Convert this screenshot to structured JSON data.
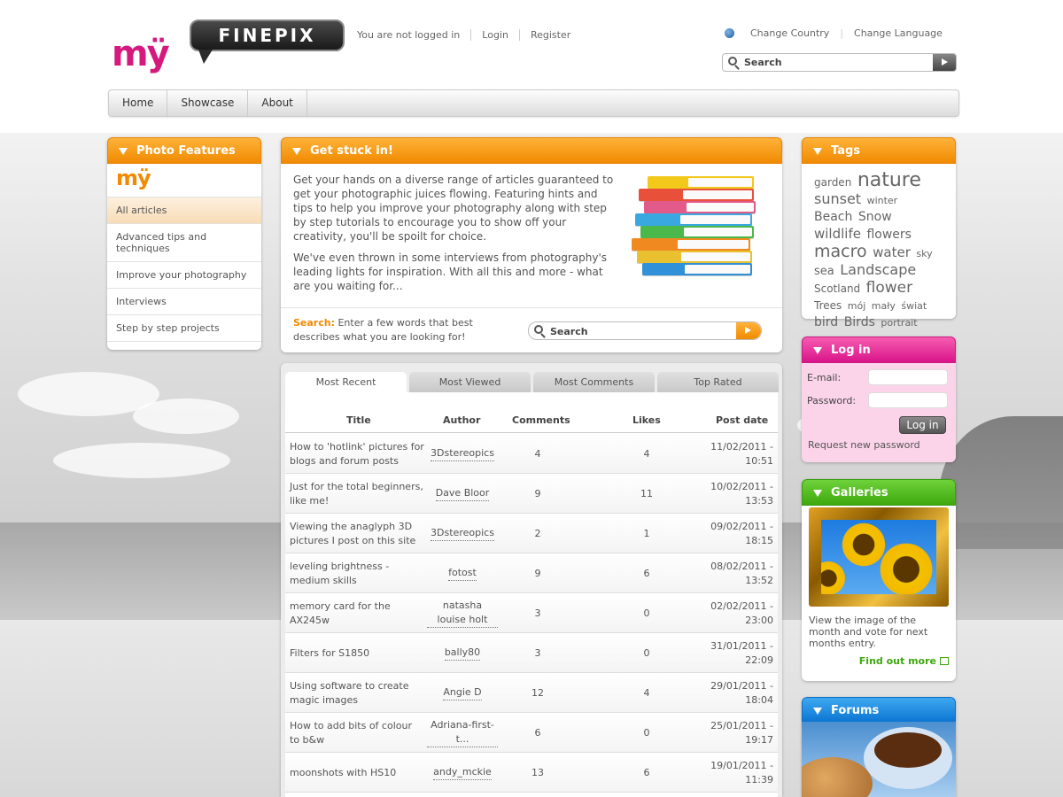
{
  "header": {
    "logo_my": "mÿ",
    "logo_text": "FINEPIX",
    "status": "You are not logged in",
    "login_link": "Login",
    "register_link": "Register",
    "change_country": "Change Country",
    "change_language": "Change Language",
    "search_placeholder": "Search"
  },
  "nav": [
    "Home",
    "Showcase",
    "About"
  ],
  "photo_features": {
    "title": "Photo Features",
    "logo": "mÿ",
    "items": [
      "All articles",
      "Advanced tips and techniques",
      "Improve your photography",
      "Interviews",
      "Step by step projects"
    ]
  },
  "main": {
    "title": "Get stuck in!",
    "para1": "Get your hands on a diverse range of articles guaranteed to get your photographic juices flowing. Featuring hints and tips to help you improve your photography along with step by step tutorials to encourage you to show off your creativity, you'll be spoilt for choice.",
    "para2": "We've even thrown in some interviews from photography's leading lights for inspiration. With all this and more - what are you waiting for...",
    "search_label": "Search:",
    "search_prompt": "Enter a few words that best describes what you are looking for!",
    "search_placeholder": "Search"
  },
  "tabs": [
    "Most Recent",
    "Most Viewed",
    "Most Comments",
    "Top Rated"
  ],
  "table": {
    "headers": [
      "Title",
      "Author",
      "Comments",
      "Likes",
      "Post date"
    ],
    "rows": [
      {
        "title": "How to 'hotlink' pictures for blogs and forum posts",
        "author": "3Dstereopics",
        "comments": "4",
        "likes": "4",
        "date": "11/02/2011 - 10:51"
      },
      {
        "title": "Just for the total beginners, like me!",
        "author": "Dave Bloor",
        "comments": "9",
        "likes": "11",
        "date": "10/02/2011 - 13:53"
      },
      {
        "title": "Viewing the anaglyph 3D pictures I post on this site",
        "author": "3Dstereopics",
        "comments": "2",
        "likes": "1",
        "date": "09/02/2011 - 18:15"
      },
      {
        "title": "leveling brightness - medium skills",
        "author": "fotost",
        "comments": "9",
        "likes": "6",
        "date": "08/02/2011 - 13:52"
      },
      {
        "title": "memory card for the AX245w",
        "author": "natasha louise holt",
        "comments": "3",
        "likes": "0",
        "date": "02/02/2011 - 23:00"
      },
      {
        "title": "Filters for S1850",
        "author": "bally80",
        "comments": "3",
        "likes": "0",
        "date": "31/01/2011 - 22:09"
      },
      {
        "title": "Using software to create magic images",
        "author": "Angie D",
        "comments": "12",
        "likes": "4",
        "date": "29/01/2011 - 18:04"
      },
      {
        "title": "How to add bits of colour to b&w",
        "author": "Adriana-first-t...",
        "comments": "6",
        "likes": "0",
        "date": "25/01/2011 - 19:17"
      },
      {
        "title": "moonshots with HS10",
        "author": "andy_mckie",
        "comments": "13",
        "likes": "6",
        "date": "19/01/2011 - 11:39"
      }
    ]
  },
  "tags": {
    "title": "Tags",
    "items": [
      {
        "text": "garden",
        "size": 12
      },
      {
        "text": "nature",
        "size": 22
      },
      {
        "text": "sunset",
        "size": 16
      },
      {
        "text": "winter",
        "size": 11
      },
      {
        "text": "Beach",
        "size": 14
      },
      {
        "text": "Snow",
        "size": 14
      },
      {
        "text": "wildlife",
        "size": 15
      },
      {
        "text": "flowers",
        "size": 14
      },
      {
        "text": "macro",
        "size": 19
      },
      {
        "text": "water",
        "size": 15
      },
      {
        "text": "sky",
        "size": 11
      },
      {
        "text": "sea",
        "size": 13
      },
      {
        "text": "Landscape",
        "size": 16
      },
      {
        "text": "Scotland",
        "size": 12
      },
      {
        "text": "flower",
        "size": 17
      },
      {
        "text": "Trees",
        "size": 12
      },
      {
        "text": "mój",
        "size": 11
      },
      {
        "text": "mały",
        "size": 11
      },
      {
        "text": "świat",
        "size": 11
      },
      {
        "text": "bird",
        "size": 14
      },
      {
        "text": "Birds",
        "size": 14
      },
      {
        "text": "portrait",
        "size": 11
      }
    ]
  },
  "login": {
    "title": "Log in",
    "email_label": "E-mail:",
    "password_label": "Password:",
    "button": "Log in",
    "request_password": "Request new password"
  },
  "galleries": {
    "title": "Galleries",
    "text": "View the image of the month and vote for next months entry.",
    "find_out": "Find out more"
  },
  "forums": {
    "title": "Forums"
  },
  "colors": {
    "orange": "#f08a00",
    "pink": "#d9148a",
    "green": "#3ea80d",
    "blue": "#0a74d2",
    "brand_pink": "#d6197d"
  }
}
